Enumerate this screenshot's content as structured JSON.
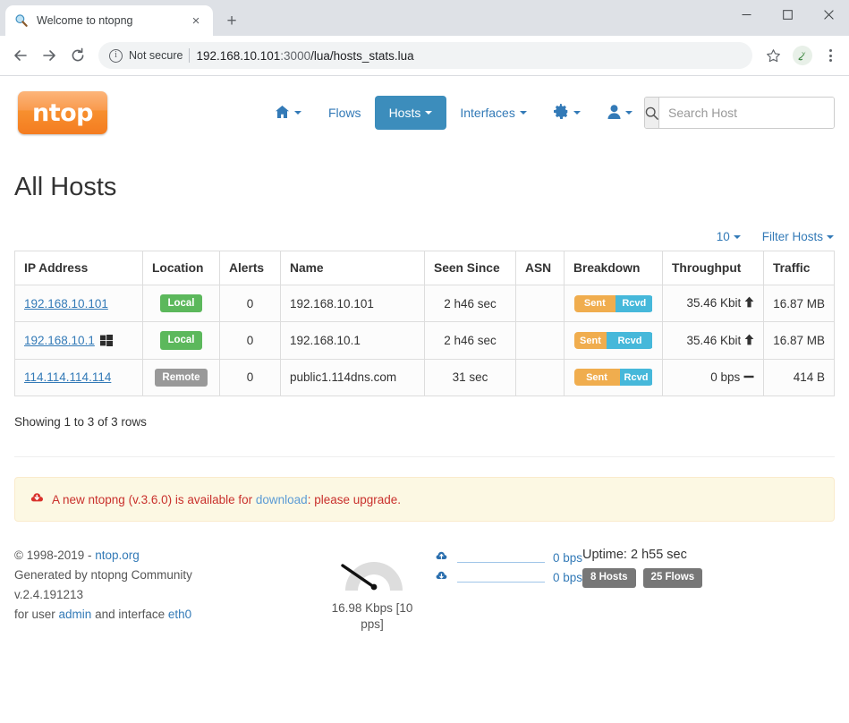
{
  "browser": {
    "tab": {
      "title": "Welcome to ntopng",
      "favicon": "magnifier-icon",
      "close": "×"
    },
    "newtab_label": "+",
    "window_controls": {
      "minimize": "minimize-icon",
      "maximize": "maximize-icon",
      "close": "close-icon"
    },
    "back": "back-arrow-icon",
    "forward": "forward-arrow-icon",
    "reload": "reload-icon",
    "security_icon": "info-circle-icon",
    "security_label": "Not secure",
    "url_host": "192.168.10.101",
    "url_port": ":3000",
    "url_path": "/lua/hosts_stats.lua",
    "bookmark": "star-icon",
    "extension": "extension-icon",
    "menu": "kebab-menu-icon"
  },
  "navbar": {
    "logo_text": "ntop",
    "items": [
      {
        "label": "",
        "icon": "home-icon",
        "caret": true,
        "active": false
      },
      {
        "label": "Flows",
        "icon": "",
        "caret": false,
        "active": false
      },
      {
        "label": "Hosts",
        "icon": "",
        "caret": true,
        "active": true
      },
      {
        "label": "Interfaces",
        "icon": "",
        "caret": true,
        "active": false
      },
      {
        "label": "",
        "icon": "gear-icon",
        "caret": true,
        "active": false
      },
      {
        "label": "",
        "icon": "user-icon",
        "caret": true,
        "active": false
      }
    ],
    "search": {
      "icon": "search-icon",
      "placeholder": "Search Host",
      "value": ""
    }
  },
  "main": {
    "page_title": "All Hosts",
    "tools": {
      "page_size": "10",
      "filter_label": "Filter Hosts"
    },
    "table": {
      "columns": [
        "IP Address",
        "Location",
        "Alerts",
        "Name",
        "Seen Since",
        "ASN",
        "Breakdown",
        "Throughput",
        "Traffic"
      ],
      "rows": [
        {
          "ip": "192.168.10.101",
          "os_icon": "",
          "location": "Local",
          "location_kind": "local",
          "alerts": "0",
          "name": "192.168.10.101",
          "seen_since": "2 h46 sec",
          "asn": "",
          "breakdown": {
            "sent_label": "Sent",
            "rcvd_label": "Rcvd",
            "sent_pct": 53
          },
          "throughput": "35.46 Kbit",
          "throughput_trend": "up",
          "traffic": "16.87 MB"
        },
        {
          "ip": "192.168.10.1",
          "os_icon": "windows-icon",
          "location": "Local",
          "location_kind": "local",
          "alerts": "0",
          "name": "192.168.10.1",
          "seen_since": "2 h46 sec",
          "asn": "",
          "breakdown": {
            "sent_label": "Sent",
            "rcvd_label": "Rcvd",
            "sent_pct": 42
          },
          "throughput": "35.46 Kbit",
          "throughput_trend": "up",
          "traffic": "16.87 MB"
        },
        {
          "ip": "114.114.114.114",
          "os_icon": "",
          "location": "Remote",
          "location_kind": "remote",
          "alerts": "0",
          "name": "public1.114dns.com",
          "seen_since": "31 sec",
          "asn": "",
          "breakdown": {
            "sent_label": "Sent",
            "rcvd_label": "Rcvd",
            "sent_pct": 58
          },
          "throughput": "0 bps",
          "throughput_trend": "flat",
          "traffic": "414 B"
        }
      ]
    },
    "showing": "Showing 1 to 3 of 3 rows"
  },
  "alert": {
    "icon": "download-alert-icon",
    "text_before": "A new ntopng (v.3.6.0) is available for ",
    "link": "download",
    "text_after": ": please upgrade."
  },
  "footer": {
    "copyright": "© 1998-2019 - ",
    "copyright_link": "ntop.org",
    "generated": "Generated by ntopng Community",
    "version": "v.2.4.191213",
    "user_prefix": "for user ",
    "user": "admin",
    "user_mid": " and interface ",
    "interface": "eth0",
    "gauge": {
      "icon": "gauge-icon",
      "label": "16.98 Kbps [10 pps]",
      "needle_angle": -58
    },
    "rates": [
      {
        "icon": "cloud-upload-icon",
        "value": "0 bps"
      },
      {
        "icon": "cloud-download-icon",
        "value": "0 bps"
      }
    ],
    "uptime": "Uptime: 2 h55 sec",
    "pills": [
      "8 Hosts",
      "25 Flows"
    ]
  },
  "colors": {
    "accent_blue": "#337ab7",
    "active_blue": "#3c8dbc",
    "orange": "#f0ad4e",
    "cyan": "#46b8da",
    "green": "#5cb85c",
    "grey": "#999999",
    "alert_bg": "#fcf8e3",
    "alert_text": "#c9302c"
  }
}
